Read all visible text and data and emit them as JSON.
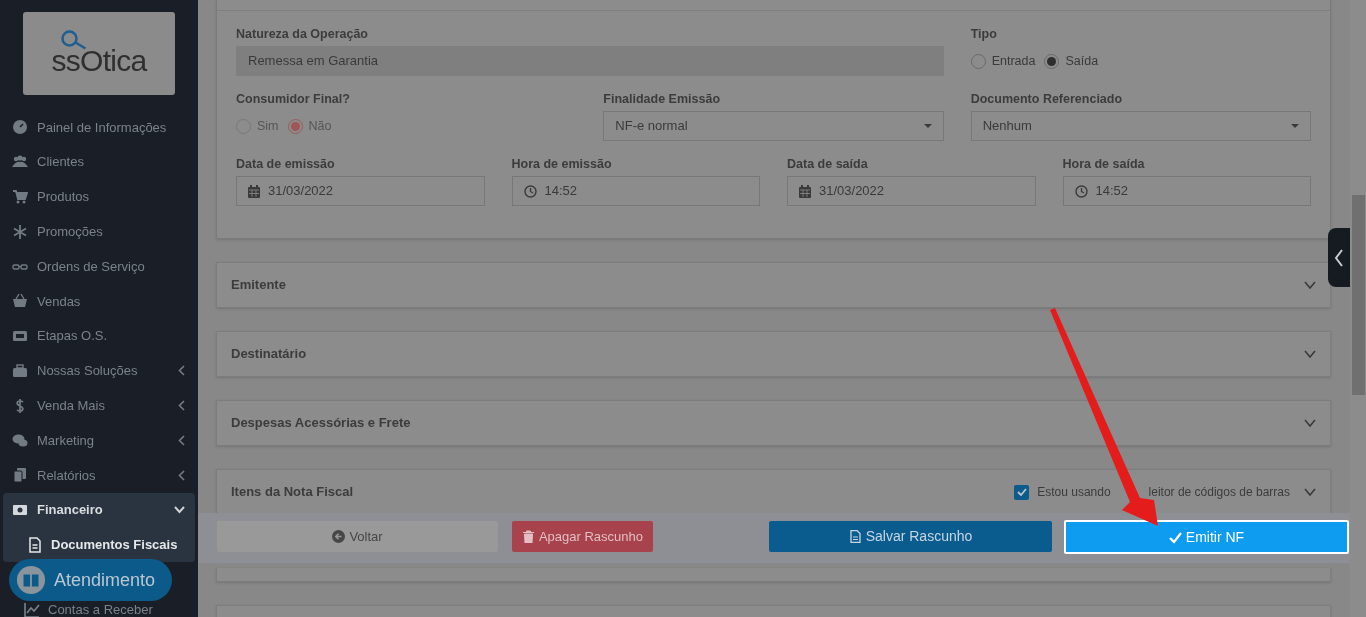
{
  "sidebar": {
    "logo": {
      "text": "ssOtica"
    },
    "items": [
      {
        "label": "Painel de Informações",
        "has_submenu": false,
        "expanded": false
      },
      {
        "label": "Clientes",
        "has_submenu": false,
        "expanded": false
      },
      {
        "label": "Produtos",
        "has_submenu": false,
        "expanded": false
      },
      {
        "label": "Promoções",
        "has_submenu": false,
        "expanded": false
      },
      {
        "label": "Ordens de Serviço",
        "has_submenu": false,
        "expanded": false
      },
      {
        "label": "Vendas",
        "has_submenu": false,
        "expanded": false
      },
      {
        "label": "Etapas O.S.",
        "has_submenu": false,
        "expanded": false
      },
      {
        "label": "Nossas Soluções",
        "has_submenu": true,
        "expanded": false
      },
      {
        "label": "Venda Mais",
        "has_submenu": true,
        "expanded": false
      },
      {
        "label": "Marketing",
        "has_submenu": true,
        "expanded": false
      },
      {
        "label": "Relatórios",
        "has_submenu": true,
        "expanded": false
      },
      {
        "label": "Financeiro",
        "has_submenu": true,
        "expanded": true,
        "children": [
          {
            "label": "Documentos Fiscais",
            "selected": true
          },
          {
            "label": "Contas a Receber",
            "selected": false
          }
        ]
      }
    ]
  },
  "support_button": {
    "label": "Atendimento"
  },
  "form": {
    "fields": [
      {
        "kind": "text",
        "label": "Natureza da Operação",
        "value": "Remessa em Garantia",
        "disabled": true
      },
      {
        "kind": "radio",
        "label": "Tipo",
        "disabled": false,
        "options": [
          {
            "label": "Entrada",
            "selected": false
          },
          {
            "label": "Saída",
            "selected": true
          }
        ]
      },
      {
        "kind": "radio",
        "label": "Consumidor Final?",
        "disabled": true,
        "options": [
          {
            "label": "Sim",
            "selected": false
          },
          {
            "label": "Não",
            "selected": true
          }
        ]
      },
      {
        "kind": "select",
        "label": "Finalidade Emissão",
        "value": "NF-e normal"
      },
      {
        "kind": "select",
        "label": "Documento Referenciado",
        "value": "Nenhum"
      },
      {
        "kind": "date",
        "label": "Data de emissão",
        "value": "31/03/2022"
      },
      {
        "kind": "time",
        "label": "Hora de emissão",
        "value": "14:52"
      },
      {
        "kind": "date",
        "label": "Data de saída",
        "value": "31/03/2022"
      },
      {
        "kind": "time",
        "label": "Hora de saída",
        "value": "14:52"
      }
    ]
  },
  "sections": [
    {
      "title": "Emitente",
      "expanded": false
    },
    {
      "title": "Destinatário",
      "expanded": false
    },
    {
      "title": "Despesas Acessórias e Frete",
      "expanded": false
    },
    {
      "title": "Itens da Nota Fiscal",
      "expanded": false,
      "barcode_option": {
        "checked": true,
        "label_start": "Estou usando",
        "label_end": "leitor de códigos de barras"
      }
    }
  ],
  "actions": [
    {
      "kind": "back",
      "label": "Voltar"
    },
    {
      "kind": "delete",
      "label": "Apagar Rascunho"
    },
    {
      "kind": "save",
      "label": "Salvar Rascunho"
    },
    {
      "kind": "submit",
      "label": "Emitir NF"
    }
  ]
}
